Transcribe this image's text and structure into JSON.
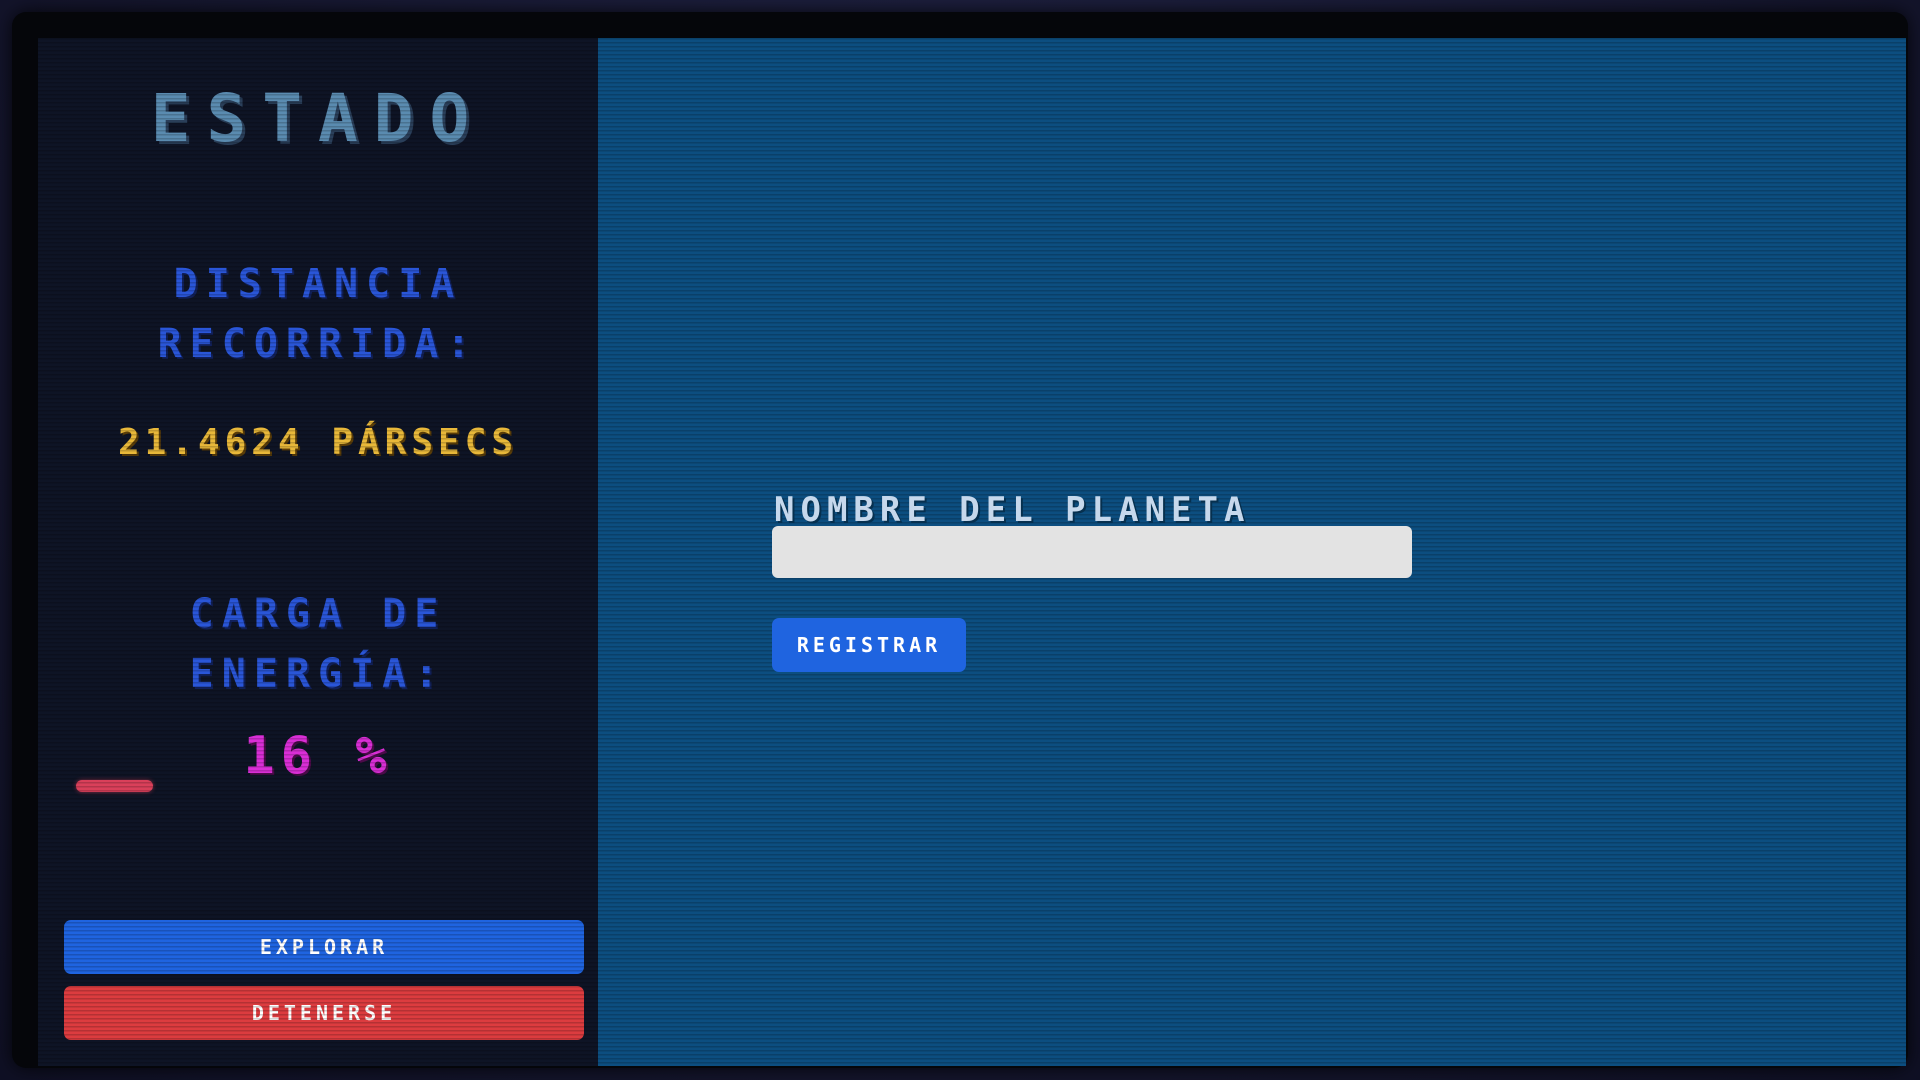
{
  "sidebar": {
    "title": "ESTADO",
    "distance_label": "DISTANCIA RECORRIDA:",
    "distance_value": "21.4624 PÁRSECS",
    "energy_label": "CARGA DE ENERGÍA:",
    "energy_value": "16 %",
    "energy_level": 0.16,
    "explore_label": "EXPLORAR",
    "stop_label": "DETENERSE"
  },
  "main": {
    "planet_name_label": "NOMBRE DEL PLANETA",
    "planet_name_value": "",
    "register_label": "REGISTRAR"
  },
  "colors": {
    "sidebar_bg": "#0e1425",
    "main_bg": "#0c4e80",
    "title": "#5a8bb0",
    "label_blue": "#2a56d8",
    "distance_yellow": "#e8b83a",
    "energy_magenta": "#d92ed6",
    "energy_bar_red": "#d9405a",
    "button_blue": "#1f64e0",
    "button_red": "#dc3c3f"
  }
}
